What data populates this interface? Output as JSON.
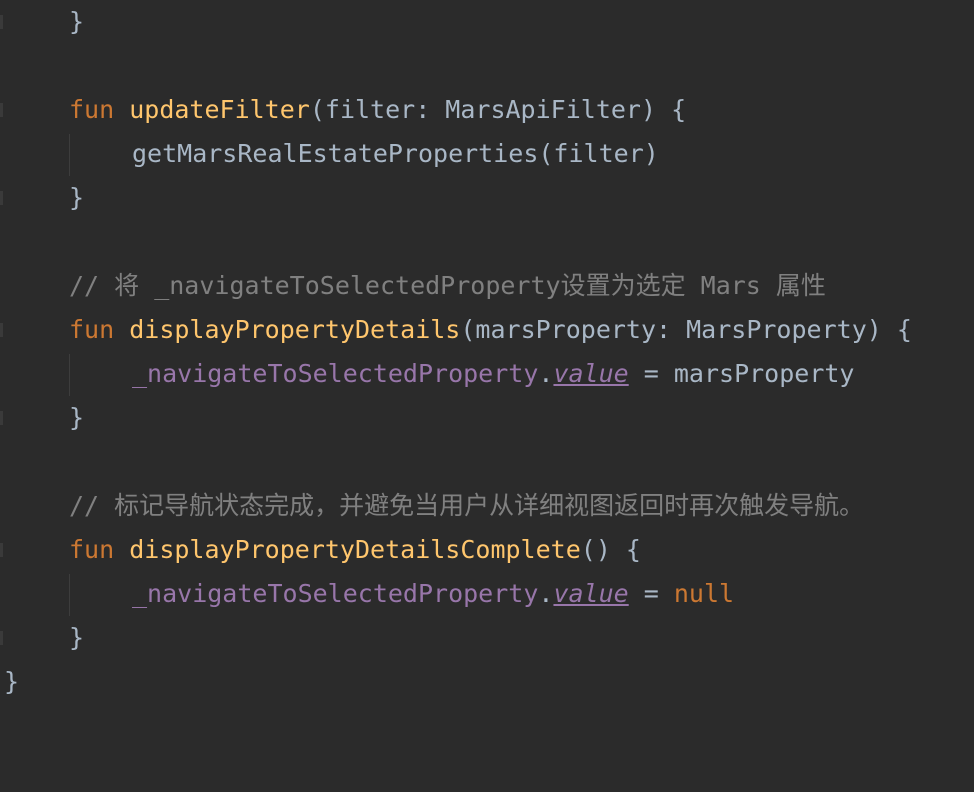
{
  "code_lines": [
    {
      "text": "}"
    },
    {
      "text": ""
    },
    {
      "kw": "fun",
      "fn": "updateFilter",
      "rest": "(filter: MarsApiFilter) {"
    },
    {
      "text": "getMarsRealEstateProperties(filter)"
    },
    {
      "text": "}"
    },
    {
      "text": ""
    },
    {
      "comment": "// 将 _navigateToSelectedProperty设置为选定 Mars 属性"
    },
    {
      "kw": "fun",
      "fn": "displayPropertyDetails",
      "rest": "(marsProperty: MarsProperty) {"
    },
    {
      "prop": "_navigateToSelectedProperty",
      "dot": ".",
      "val": "value",
      "rest": " = marsProperty"
    },
    {
      "text": "}"
    },
    {
      "text": ""
    },
    {
      "comment": "// 标记导航状态完成，并避免当用户从详细视图返回时再次触发导航。"
    },
    {
      "kw": "fun",
      "fn": "displayPropertyDetailsComplete",
      "rest": "() {"
    },
    {
      "prop": "_navigateToSelectedProperty",
      "dot": ".",
      "val": "value",
      "rest": " = ",
      "kw2": "null"
    },
    {
      "text": "}"
    },
    {
      "text": "}"
    }
  ],
  "colors": {
    "background": "#2b2b2b",
    "keyword": "#cc7832",
    "function": "#ffc66d",
    "property": "#9876aa",
    "text": "#a9b7c6",
    "comment": "#808080"
  }
}
